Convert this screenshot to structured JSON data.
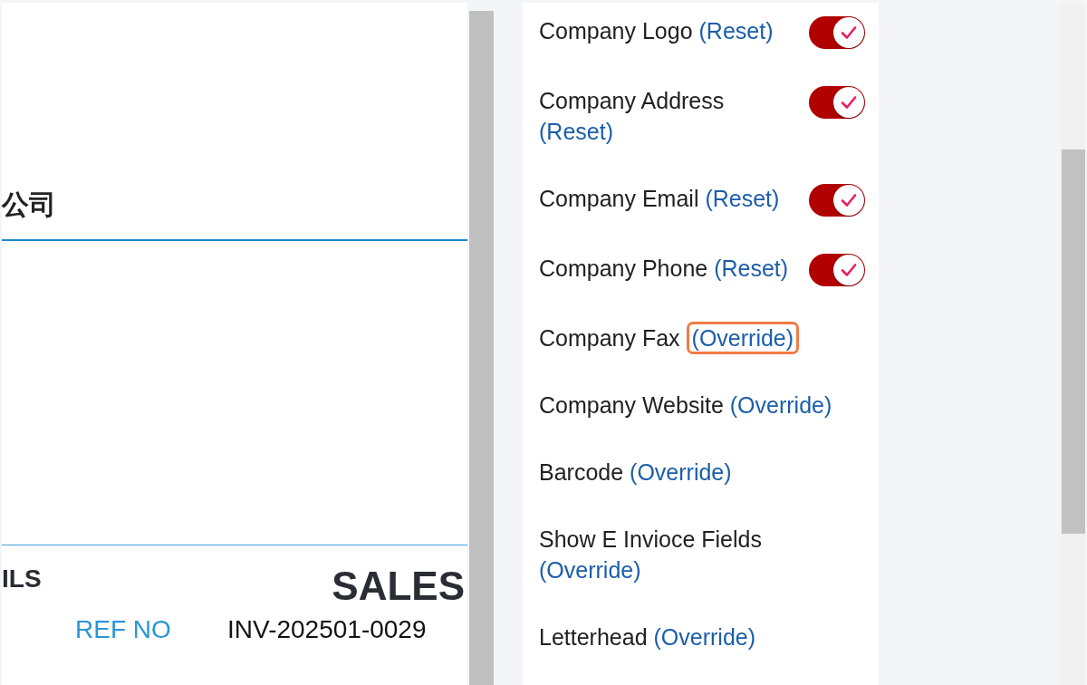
{
  "preview": {
    "company_name": "公司",
    "section_heading": "ILS",
    "document_title": "SALES",
    "ref_label": "REF NO",
    "ref_value": "INV-202501-0029"
  },
  "settings": {
    "items": [
      {
        "kind": "switch",
        "label": "Company Logo",
        "action": "(Reset)",
        "on": true,
        "highlighted": false
      },
      {
        "kind": "switch",
        "label": "Company Address",
        "action": "(Reset)",
        "on": true,
        "highlighted": false
      },
      {
        "kind": "switch",
        "label": "Company Email",
        "action": "(Reset)",
        "on": true,
        "highlighted": false
      },
      {
        "kind": "switch",
        "label": "Company Phone",
        "action": "(Reset)",
        "on": true,
        "highlighted": false
      },
      {
        "kind": "plain",
        "label": "Company Fax",
        "action": "(Override)",
        "highlighted": true
      },
      {
        "kind": "plain",
        "label": "Company Website",
        "action": "(Override)",
        "highlighted": false
      },
      {
        "kind": "plain",
        "label": "Barcode",
        "action": "(Override)",
        "highlighted": false
      },
      {
        "kind": "plain",
        "label": "Show E Invioce Fields",
        "action": "(Override)",
        "highlighted": false
      },
      {
        "kind": "plain",
        "label": "Letterhead",
        "action": "(Override)",
        "highlighted": false
      }
    ]
  }
}
